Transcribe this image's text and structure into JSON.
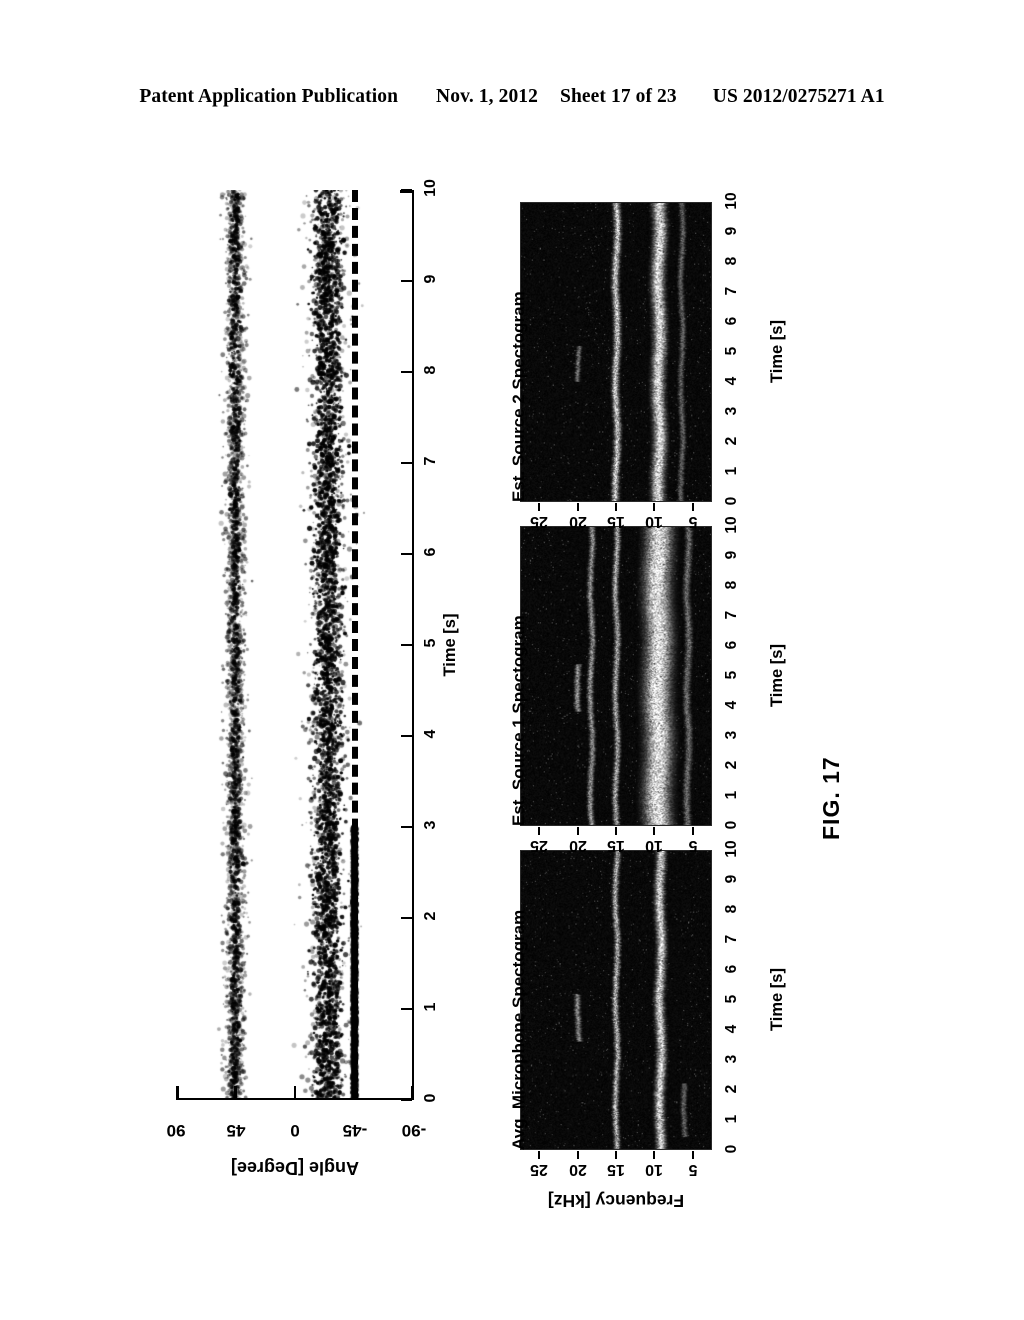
{
  "header": {
    "publication": "Patent Application Publication",
    "date": "Nov. 1, 2012",
    "sheet": "Sheet 17 of 23",
    "number": "US 2012/0275271 A1"
  },
  "figure": {
    "label": "FIG. 17",
    "orientation": "rotated-90-ccw"
  },
  "chart_data": [
    {
      "type": "scatter",
      "title": "",
      "xlabel": "Time [s]",
      "ylabel": "Angle [Degree]",
      "xlim": [
        0,
        10
      ],
      "ylim": [
        -90,
        90
      ],
      "xticks": [
        "0",
        "1",
        "2",
        "3",
        "4",
        "5",
        "6",
        "7",
        "8",
        "9",
        "10"
      ],
      "yticks": [
        "90",
        "45",
        "0",
        "-45",
        "-90"
      ],
      "grid": false,
      "annotations": [
        {
          "kind": "dashed-reference-line",
          "axis": "y",
          "value": -45
        }
      ],
      "series": [
        {
          "name": "upper-band-estimates",
          "center_deg": 45,
          "spread_deg": 9,
          "marker": "dot",
          "color": "#000000"
        },
        {
          "name": "lower-band-estimates",
          "center_deg": -25,
          "spread_deg": 12,
          "marker": "dot",
          "color": "#000000"
        },
        {
          "name": "locked-track",
          "center_deg": -45,
          "spread_deg": 1,
          "x_range": [
            0,
            3
          ],
          "marker": "dot",
          "color": "#000000"
        }
      ]
    },
    {
      "type": "heatmap",
      "title": "Avg. Microphone Spectogram",
      "xlabel": "Time [s]",
      "ylabel": "Frequency [kHz]",
      "xlim": [
        0,
        10
      ],
      "ylim": [
        2.5,
        27.5
      ],
      "xticks": [
        "0",
        "1",
        "2",
        "3",
        "4",
        "5",
        "6",
        "7",
        "8",
        "9",
        "10"
      ],
      "yticks": [
        "25",
        "20",
        "15",
        "10",
        "5"
      ],
      "background": "#050505",
      "bands": [
        {
          "freq_khz": 20.0,
          "intensity": 0.55,
          "width_khz": 0.5,
          "t_range": [
            3.6,
            5.2
          ]
        },
        {
          "freq_khz": 15.0,
          "intensity": 0.75,
          "width_khz": 0.5
        },
        {
          "freq_khz": 9.2,
          "intensity": 0.9,
          "width_khz": 0.8
        },
        {
          "freq_khz": 6.0,
          "intensity": 0.4,
          "width_khz": 0.5,
          "t_range": [
            0.4,
            2.2
          ]
        }
      ]
    },
    {
      "type": "heatmap",
      "title": "Est. Source 1 Spectogram",
      "xlabel": "Time [s]",
      "ylabel": "Frequency [kHz]",
      "xlim": [
        0,
        10
      ],
      "ylim": [
        2.5,
        27.5
      ],
      "xticks": [
        "0",
        "1",
        "2",
        "3",
        "4",
        "5",
        "6",
        "7",
        "8",
        "9",
        "10"
      ],
      "yticks": [
        "25",
        "20",
        "15",
        "10",
        "5"
      ],
      "background": "#050505",
      "bands": [
        {
          "freq_khz": 20.0,
          "intensity": 0.6,
          "width_khz": 0.5,
          "t_range": [
            3.8,
            5.4
          ]
        },
        {
          "freq_khz": 18.3,
          "intensity": 0.6,
          "width_khz": 0.5
        },
        {
          "freq_khz": 15.0,
          "intensity": 0.7,
          "width_khz": 0.5
        },
        {
          "freq_khz": 9.5,
          "intensity": 1.0,
          "width_khz": 2.2
        },
        {
          "freq_khz": 5.6,
          "intensity": 0.45,
          "width_khz": 0.6
        }
      ]
    },
    {
      "type": "heatmap",
      "title": "Est. Source 2 Spectogram",
      "xlabel": "Time [s]",
      "ylabel": "Frequency [kHz]",
      "xlim": [
        0,
        10
      ],
      "ylim": [
        2.5,
        27.5
      ],
      "xticks": [
        "0",
        "1",
        "2",
        "3",
        "4",
        "5",
        "6",
        "7",
        "8",
        "9",
        "10"
      ],
      "yticks": [
        "25",
        "20",
        "15",
        "10",
        "5"
      ],
      "background": "#050505",
      "bands": [
        {
          "freq_khz": 20.0,
          "intensity": 0.5,
          "width_khz": 0.4,
          "t_range": [
            4.0,
            5.2
          ]
        },
        {
          "freq_khz": 15.0,
          "intensity": 0.85,
          "width_khz": 0.6
        },
        {
          "freq_khz": 9.4,
          "intensity": 0.95,
          "width_khz": 1.1
        },
        {
          "freq_khz": 6.4,
          "intensity": 0.4,
          "width_khz": 0.5
        }
      ]
    }
  ]
}
